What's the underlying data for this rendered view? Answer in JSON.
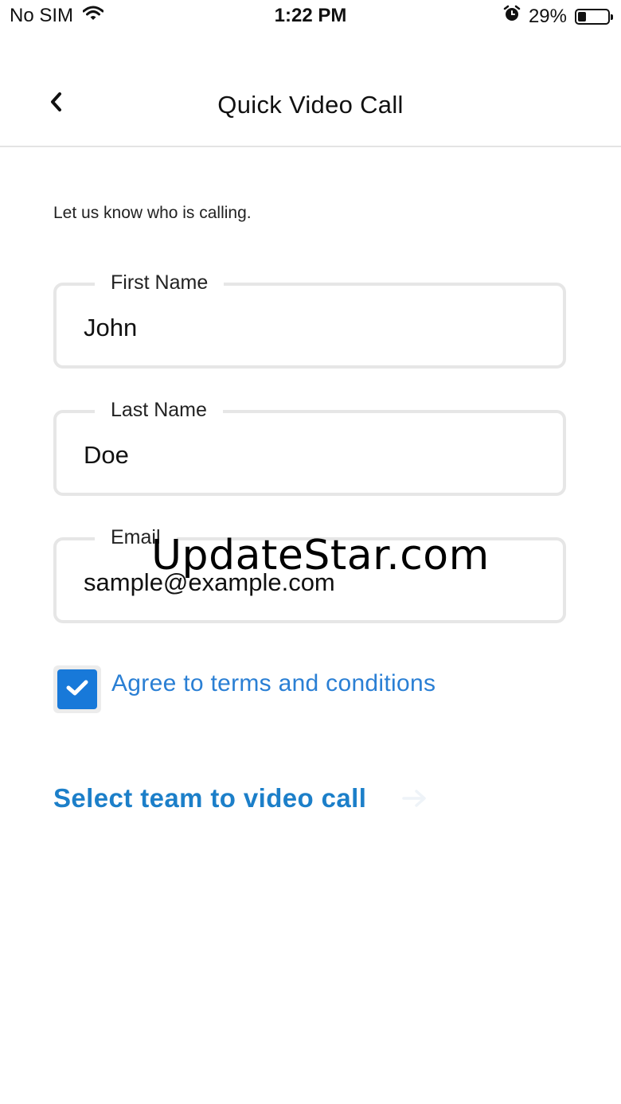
{
  "status_bar": {
    "carrier": "No SIM",
    "time": "1:22 PM",
    "battery_percent": "29%",
    "battery_level": 0.29,
    "icons": [
      "wifi-icon",
      "alarm-icon",
      "battery-icon"
    ]
  },
  "nav": {
    "title": "Quick Video Call",
    "back_icon": "chevron-left-icon"
  },
  "form": {
    "intro": "Let us know who is calling.",
    "first_name": {
      "label": "First Name",
      "value": "John"
    },
    "last_name": {
      "label": "Last Name",
      "value": "Doe"
    },
    "email": {
      "label": "Email",
      "value": "sample@example.com"
    },
    "terms": {
      "label": "Agree to terms and conditions",
      "checked": true
    }
  },
  "action": {
    "label": "Select team to video call",
    "icon": "arrow-right-icon"
  },
  "watermark": "UpdateStar.com",
  "colors": {
    "accent": "#1879d9",
    "link": "#2a7fd4",
    "action": "#1c7fc9",
    "field_border": "#e6e6e6"
  }
}
